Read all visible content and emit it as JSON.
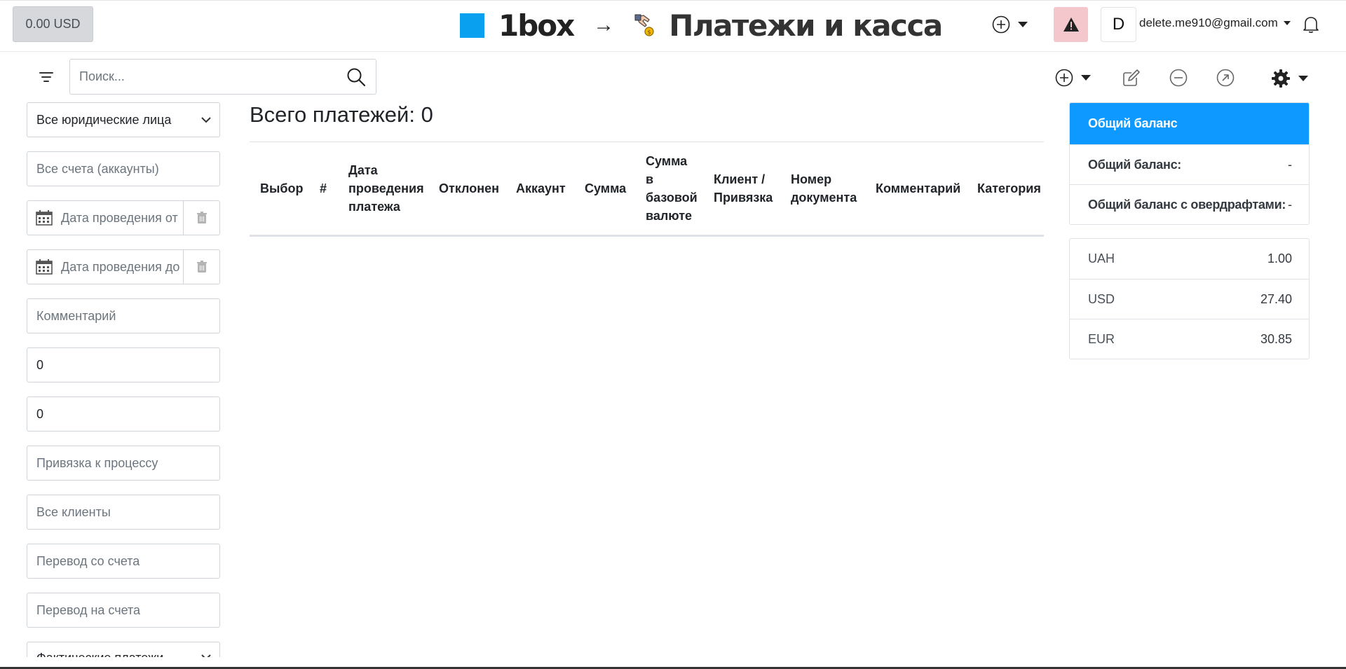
{
  "header": {
    "balance_button": "0.00 USD",
    "brand_name": "1box",
    "arrow": "→",
    "page_title": "Платежи и касса",
    "user_initial": "D",
    "user_email": "delete.me910@gmail.com"
  },
  "toolbar": {
    "search_placeholder": "Поиск..."
  },
  "filters": {
    "legal_entities": "Все юридические лица",
    "accounts_placeholder": "Все счета (аккаунты)",
    "date_from_placeholder": "Дата проведения от",
    "date_to_placeholder": "Дата проведения до",
    "comment_placeholder": "Комментарий",
    "amount_from": "0",
    "amount_to": "0",
    "process_link_placeholder": "Привязка к процессу",
    "clients_placeholder": "Все клиенты",
    "transfer_from_placeholder": "Перевод со счета",
    "transfer_to_placeholder": "Перевод на счета",
    "payment_type": "Фактические платежи"
  },
  "main": {
    "total_label": "Всего платежей: 0",
    "columns": [
      "Выбор",
      "#",
      "Дата проведения платежа",
      "Отклонен",
      "Аккаунт",
      "Сумма",
      "Сумма в базовой валюте",
      "Клиент / Привязка",
      "Номер документа",
      "Комментарий",
      "Категория"
    ]
  },
  "balance": {
    "title": "Общий баланс",
    "rows": [
      {
        "label": "Общий баланс:",
        "value": "-"
      },
      {
        "label": "Общий баланс с овердрафтами:",
        "value": "-"
      }
    ]
  },
  "currencies": [
    {
      "code": "UAH",
      "rate": "1.00"
    },
    {
      "code": "USD",
      "rate": "27.40"
    },
    {
      "code": "EUR",
      "rate": "30.85"
    }
  ],
  "colors": {
    "accent": "#0d99ff",
    "brand_square": "#0aa0f0",
    "alert_bg": "#f3c7cb"
  }
}
